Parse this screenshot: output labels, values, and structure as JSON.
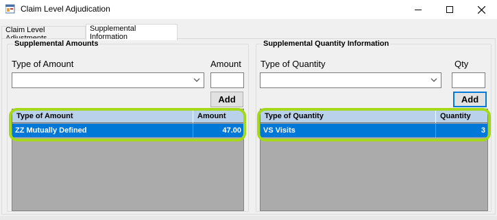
{
  "window": {
    "title": "Claim Level Adjudication"
  },
  "tabs": [
    {
      "label": "Claim Level Adjustments",
      "selected": false
    },
    {
      "label": "Supplemental Information",
      "selected": true
    }
  ],
  "amounts": {
    "group_title": "Supplemental Amounts",
    "type_label": "Type of Amount",
    "amount_label": "Amount",
    "type_value": "",
    "amount_value": "",
    "add_label": "Add",
    "columns": [
      "Type of Amount",
      "Amount"
    ],
    "rows": [
      {
        "type": "ZZ Mutually Defined",
        "amount": "47.00"
      }
    ]
  },
  "quantity": {
    "group_title": "Supplemental Quantity Information",
    "type_label": "Type of Quantity",
    "qty_label": "Qty",
    "type_value": "",
    "qty_value": "",
    "add_label": "Add",
    "columns": [
      "Type of Quantity",
      "Quantity"
    ],
    "rows": [
      {
        "type": "VS Visits",
        "quantity": "3"
      }
    ]
  },
  "colors": {
    "selection": "#0078d7",
    "header": "#b9d1ea",
    "highlight": "#a5d81a"
  }
}
